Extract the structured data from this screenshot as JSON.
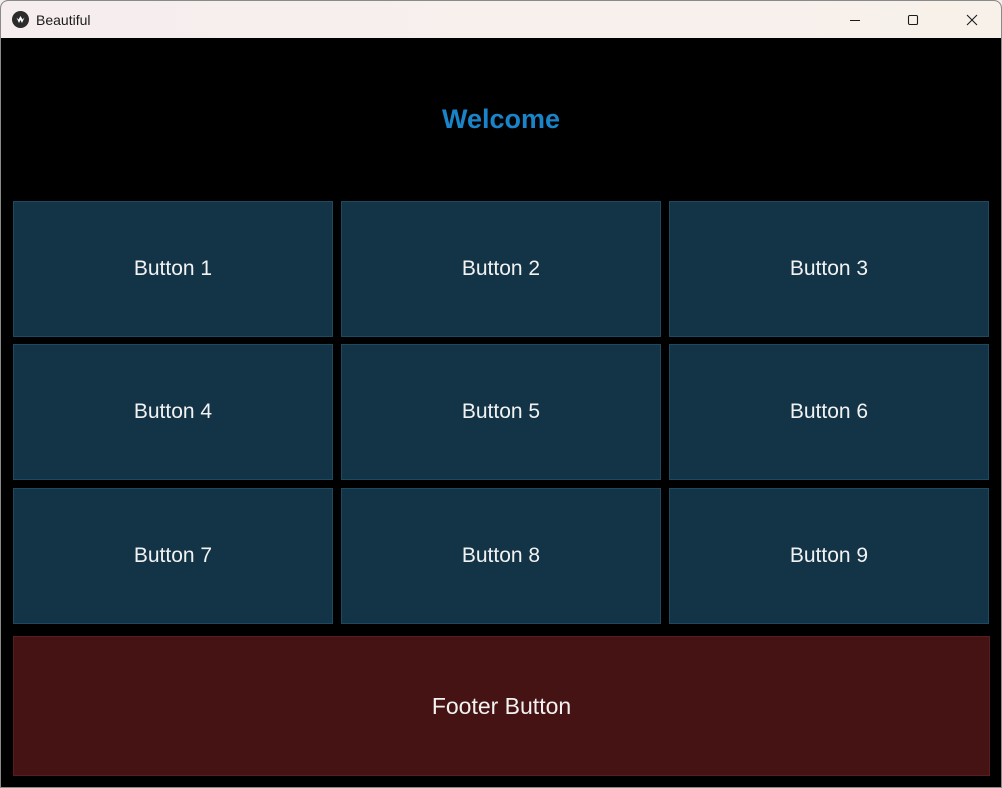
{
  "window": {
    "title": "Beautiful",
    "app_icon": "kivy-icon",
    "controls": {
      "minimize": "minimize-icon",
      "maximize": "maximize-icon",
      "close": "close-icon"
    }
  },
  "main": {
    "heading": "Welcome",
    "heading_color": "#1a84c9",
    "grid_color": "#133446",
    "footer_color": "#461314",
    "buttons": [
      {
        "label": "Button 1"
      },
      {
        "label": "Button 2"
      },
      {
        "label": "Button 3"
      },
      {
        "label": "Button 4"
      },
      {
        "label": "Button 5"
      },
      {
        "label": "Button 6"
      },
      {
        "label": "Button 7"
      },
      {
        "label": "Button 8"
      },
      {
        "label": "Button 9"
      }
    ],
    "footer_label": "Footer Button"
  }
}
